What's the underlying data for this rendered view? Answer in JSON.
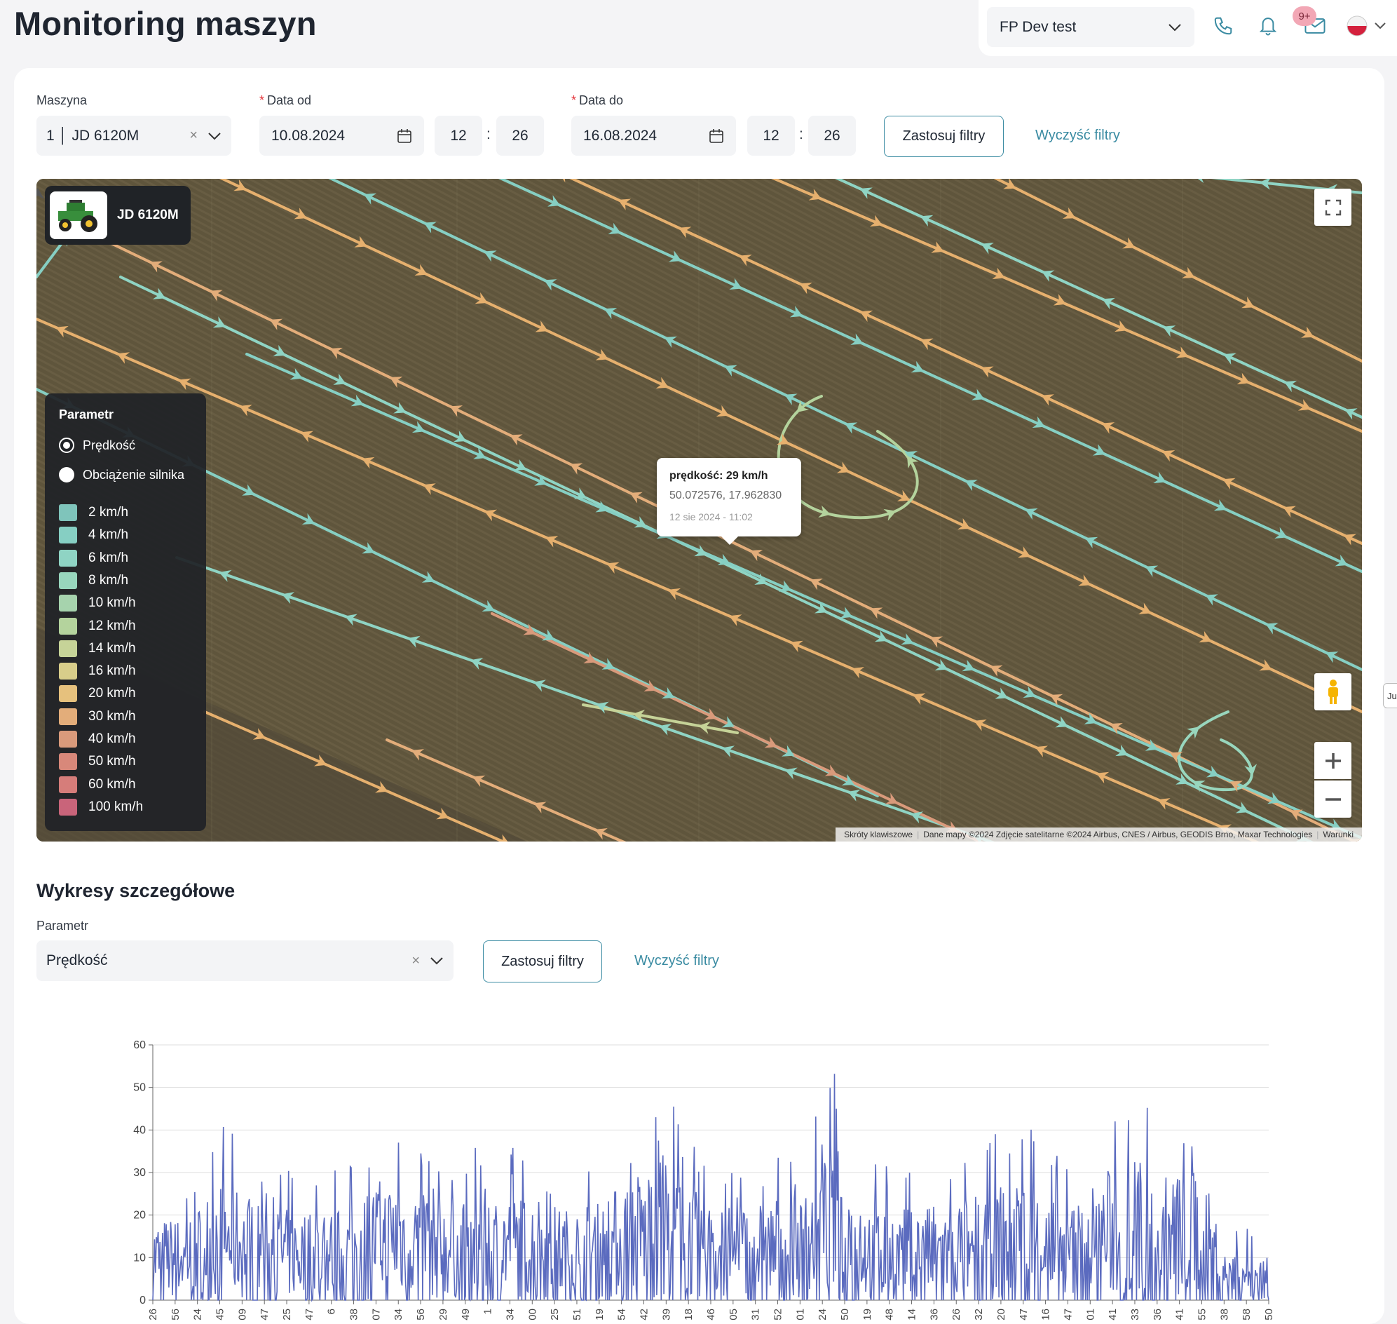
{
  "header": {
    "title": "Monitoring maszyn",
    "company_select": "FP Dev test",
    "notifications_badge": "9+",
    "language": "pl"
  },
  "filters": {
    "machine_label": "Maszyna",
    "machine_value": "1 │ JD 6120M",
    "date_from_label": "Data od",
    "date_from": "10.08.2024",
    "date_from_hour": "12",
    "date_from_minute": "26",
    "date_to_label": "Data do",
    "date_to": "16.08.2024",
    "date_to_hour": "12",
    "date_to_minute": "26",
    "time_separator": ":",
    "apply_label": "Zastosuj filtry",
    "clear_label": "Wyczyść filtry"
  },
  "map": {
    "machine_name": "JD 6120M",
    "legend_title": "Parametr",
    "param_options": [
      {
        "label": "Prędkość",
        "selected": true
      },
      {
        "label": "Obciążenie silnika",
        "selected": false
      }
    ],
    "scale": [
      {
        "label": "2 km/h",
        "color": "#7fc4bb"
      },
      {
        "label": "4 km/h",
        "color": "#86cfc3"
      },
      {
        "label": "6 km/h",
        "color": "#8fd4c4"
      },
      {
        "label": "8 km/h",
        "color": "#98d6bd"
      },
      {
        "label": "10 km/h",
        "color": "#a6d3ad"
      },
      {
        "label": "12 km/h",
        "color": "#b4d39d"
      },
      {
        "label": "14 km/h",
        "color": "#c6d398"
      },
      {
        "label": "16 km/h",
        "color": "#d8cd8a"
      },
      {
        "label": "20 km/h",
        "color": "#e6c17d"
      },
      {
        "label": "30 km/h",
        "color": "#e3ad7a"
      },
      {
        "label": "40 km/h",
        "color": "#d99a7b"
      },
      {
        "label": "50 km/h",
        "color": "#d8887a"
      },
      {
        "label": "60 km/h",
        "color": "#d67d7a"
      },
      {
        "label": "100 km/h",
        "color": "#c9647a"
      }
    ],
    "tooltip": {
      "title": "prędkość: 29 km/h",
      "coords": "50.072576, 17.962830",
      "time": "12 sie 2024 - 11:02"
    },
    "attribution": {
      "shortcuts": "Skróty klawiszowe",
      "data": "Dane mapy ©2024 Zdjęcie satelitarne ©2024 Airbus, CNES / Airbus, GEODIS Brno, Maxar Technologies",
      "terms": "Warunki"
    },
    "side_tab": "Ju"
  },
  "details": {
    "title": "Wykresy szczegółowe",
    "param_label": "Parametr",
    "param_value": "Prędkość",
    "apply_label": "Zastosuj filtry",
    "clear_label": "Wyczyść filtry"
  },
  "chart_data": {
    "type": "line",
    "title": "",
    "xlabel": "",
    "ylabel": "",
    "ylim": [
      0,
      60
    ],
    "yticks": [
      0,
      10,
      20,
      30,
      40,
      50,
      60
    ],
    "color": "#5b6bbf",
    "xtick_labels": [
      "26",
      "56",
      "24",
      "45",
      "09",
      "47",
      "25",
      "47",
      "6",
      "38",
      "07",
      "34",
      "56",
      "29",
      "49",
      "1",
      "34",
      "00",
      "25",
      "51",
      "19",
      "54",
      "42",
      "39",
      "18",
      "46",
      "05",
      "31",
      "52",
      "01",
      "24",
      "50",
      "19",
      "48",
      "14",
      "36",
      "26",
      "32",
      "20",
      "47",
      "16",
      "47",
      "01",
      "41",
      "33",
      "36",
      "41",
      "55",
      "38",
      "58",
      "50"
    ],
    "envelope_x": [
      0,
      0.03,
      0.06,
      0.1,
      0.13,
      0.17,
      0.2,
      0.24,
      0.27,
      0.3,
      0.33,
      0.37,
      0.4,
      0.43,
      0.46,
      0.49,
      0.52,
      0.55,
      0.58,
      0.61,
      0.64,
      0.67,
      0.7,
      0.73,
      0.76,
      0.79,
      0.82,
      0.85,
      0.88,
      0.9,
      0.92,
      0.94,
      0.96,
      0.98,
      1.0
    ],
    "envelope_y": [
      28,
      28,
      42,
      32,
      30,
      31,
      41,
      42,
      32,
      38,
      36,
      31,
      33,
      43,
      50,
      35,
      31,
      35,
      34,
      54,
      34,
      31,
      32,
      35,
      40,
      43,
      31,
      43,
      50,
      42,
      43,
      43,
      22,
      17,
      14
    ],
    "samples": 1250
  }
}
